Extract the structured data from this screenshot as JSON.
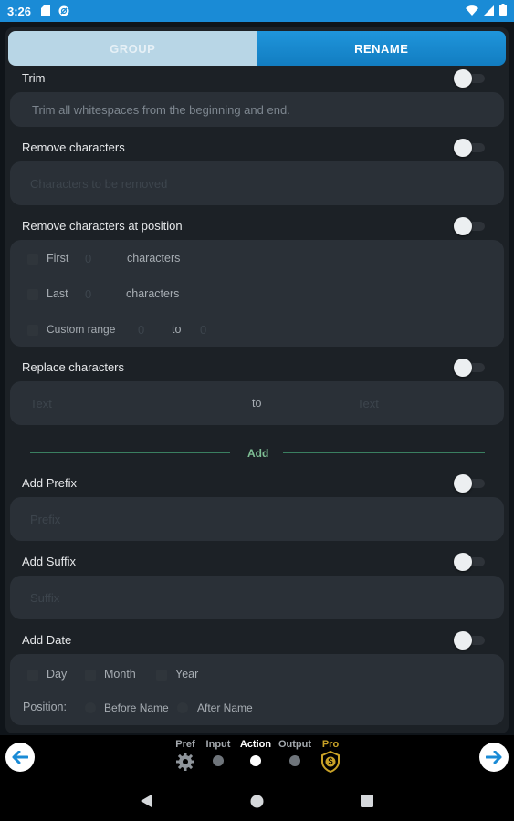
{
  "status_bar": {
    "time": "3:26"
  },
  "tabs": {
    "group": "GROUP",
    "rename": "RENAME"
  },
  "trim": {
    "title": "Trim",
    "placeholder": "Trim all whitespaces from the beginning and end."
  },
  "remove_characters": {
    "title": "Remove characters",
    "placeholder": "Characters to be removed"
  },
  "remove_at_position": {
    "title": "Remove characters at position",
    "first_label": "First",
    "first_value": "0",
    "first_unit": "characters",
    "last_label": "Last",
    "last_value": "0",
    "last_unit": "characters",
    "custom_label": "Custom range",
    "range_from": "0",
    "range_to_label": "to",
    "range_to": "0"
  },
  "replace_characters": {
    "title": "Replace characters",
    "from_placeholder": "Text",
    "to_label": "to",
    "to_placeholder": "Text"
  },
  "add_section": {
    "label": "Add"
  },
  "add_prefix": {
    "title": "Add Prefix",
    "placeholder": "Prefix"
  },
  "add_suffix": {
    "title": "Add Suffix",
    "placeholder": "Suffix"
  },
  "add_date": {
    "title": "Add Date",
    "day": "Day",
    "month": "Month",
    "year": "Year",
    "position_label": "Position:",
    "before_name": "Before Name",
    "after_name": "After Name"
  },
  "steps": [
    {
      "label": "Pref",
      "icon": "gear-icon"
    },
    {
      "label": "Input"
    },
    {
      "label": "Action"
    },
    {
      "label": "Output"
    },
    {
      "label": "Pro",
      "icon": "dollar-shield-icon"
    }
  ],
  "colors": {
    "accent": "#1a8bd6",
    "pro": "#c9a227",
    "divider": "#3a7f60"
  }
}
